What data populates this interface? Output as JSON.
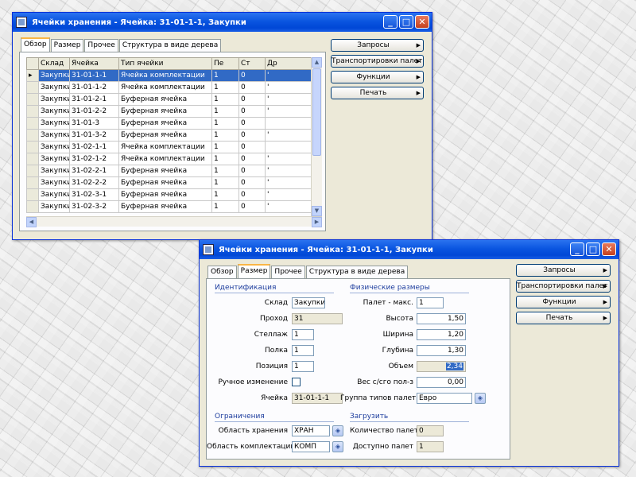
{
  "w1": {
    "title": "Ячейки хранения - Ячейка: 31-01-1-1, Закупки",
    "tabs": [
      "Обзор",
      "Размер",
      "Прочее",
      "Структура в виде дерева"
    ],
    "columns": [
      "Склад",
      "Ячейка",
      "Тип ячейки",
      "Пе",
      "Ст",
      "Др"
    ],
    "rows": [
      [
        "Закупки",
        "31-01-1-1",
        "Ячейка комплектации",
        "1",
        "0",
        "'"
      ],
      [
        "Закупки",
        "31-01-1-2",
        "Ячейка комплектации",
        "1",
        "0",
        "'"
      ],
      [
        "Закупки",
        "31-01-2-1",
        "Буферная ячейка",
        "1",
        "0",
        "'"
      ],
      [
        "Закупки",
        "31-01-2-2",
        "Буферная ячейка",
        "1",
        "0",
        "'"
      ],
      [
        "Закупки",
        "31-01-3",
        "Буферная ячейка",
        "1",
        "0",
        ""
      ],
      [
        "Закупки",
        "31-01-3-2",
        "Буферная ячейка",
        "1",
        "0",
        "'"
      ],
      [
        "Закупки",
        "31-02-1-1",
        "Ячейка комплектации",
        "1",
        "0",
        ""
      ],
      [
        "Закупки",
        "31-02-1-2",
        "Ячейка комплектации",
        "1",
        "0",
        "'"
      ],
      [
        "Закупки",
        "31-02-2-1",
        "Буферная ячейка",
        "1",
        "0",
        "'"
      ],
      [
        "Закупки",
        "31-02-2-2",
        "Буферная ячейка",
        "1",
        "0",
        "'"
      ],
      [
        "Закупки",
        "31-02-3-1",
        "Буферная ячейка",
        "1",
        "0",
        "'"
      ],
      [
        "Закупки",
        "31-02-3-2",
        "Буферная ячейка",
        "1",
        "0",
        "'"
      ]
    ],
    "row_marker": "▸",
    "buttons": [
      "Запросы",
      "Транспортировки палет",
      "Функции",
      "Печать"
    ]
  },
  "w2": {
    "title": "Ячейки хранения - Ячейка: 31-01-1-1, Закупки",
    "tabs": [
      "Обзор",
      "Размер",
      "Прочее",
      "Структура в виде дерева"
    ],
    "buttons": [
      "Запросы",
      "Транспортировки палет",
      "Функции",
      "Печать"
    ],
    "sec_ident": "Идентификация",
    "sec_dims": "Физические размеры",
    "sec_restrict": "Ограничения",
    "sec_load": "Загрузить",
    "left_fields": [
      {
        "label": "Склад",
        "value": "Закупки"
      },
      {
        "label": "Проход",
        "value": "31"
      },
      {
        "label": "Стеллаж",
        "value": "1"
      },
      {
        "label": "Полка",
        "value": "1"
      },
      {
        "label": "Позиция",
        "value": "1"
      }
    ],
    "manual_label": "Ручное изменение",
    "cell_label": "Ячейка",
    "cell_value": "31-01-1-1",
    "right_fields": [
      {
        "label": "Палет - макс.",
        "value": "1"
      },
      {
        "label": "Высота",
        "value": "1,50"
      },
      {
        "label": "Ширина",
        "value": "1,20"
      },
      {
        "label": "Глубина",
        "value": "1,30"
      },
      {
        "label": "Объем",
        "value": "2,34"
      },
      {
        "label": "Вес с/сго пол-з",
        "value": "0,00"
      }
    ],
    "pallet_label": "Группа типов палет",
    "pallet_value": "Евро",
    "restrict": [
      {
        "label": "Область хранения",
        "value": "ХРАН"
      },
      {
        "label": "Область комплектации",
        "value": "КОМП"
      }
    ],
    "load": [
      {
        "label": "Количество палет",
        "value": "0"
      },
      {
        "label": "Доступно палет",
        "value": "1"
      }
    ]
  }
}
